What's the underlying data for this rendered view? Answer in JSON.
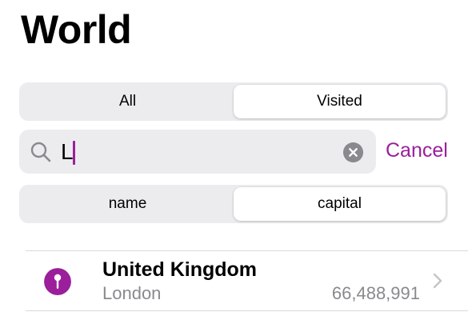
{
  "header": {
    "title": "World"
  },
  "filter": {
    "options": [
      "All",
      "Visited"
    ],
    "selected": "Visited"
  },
  "search": {
    "value": "L",
    "cancel_label": "Cancel"
  },
  "scope": {
    "options": [
      "name",
      "capital"
    ],
    "selected": "capital"
  },
  "results": [
    {
      "name": "United Kingdom",
      "capital": "London",
      "population": "66,488,991",
      "icon": "pin-icon"
    }
  ],
  "colors": {
    "accent": "#9b1f9b",
    "secondary_text": "#8a8a8e",
    "control_background": "#ececef"
  }
}
